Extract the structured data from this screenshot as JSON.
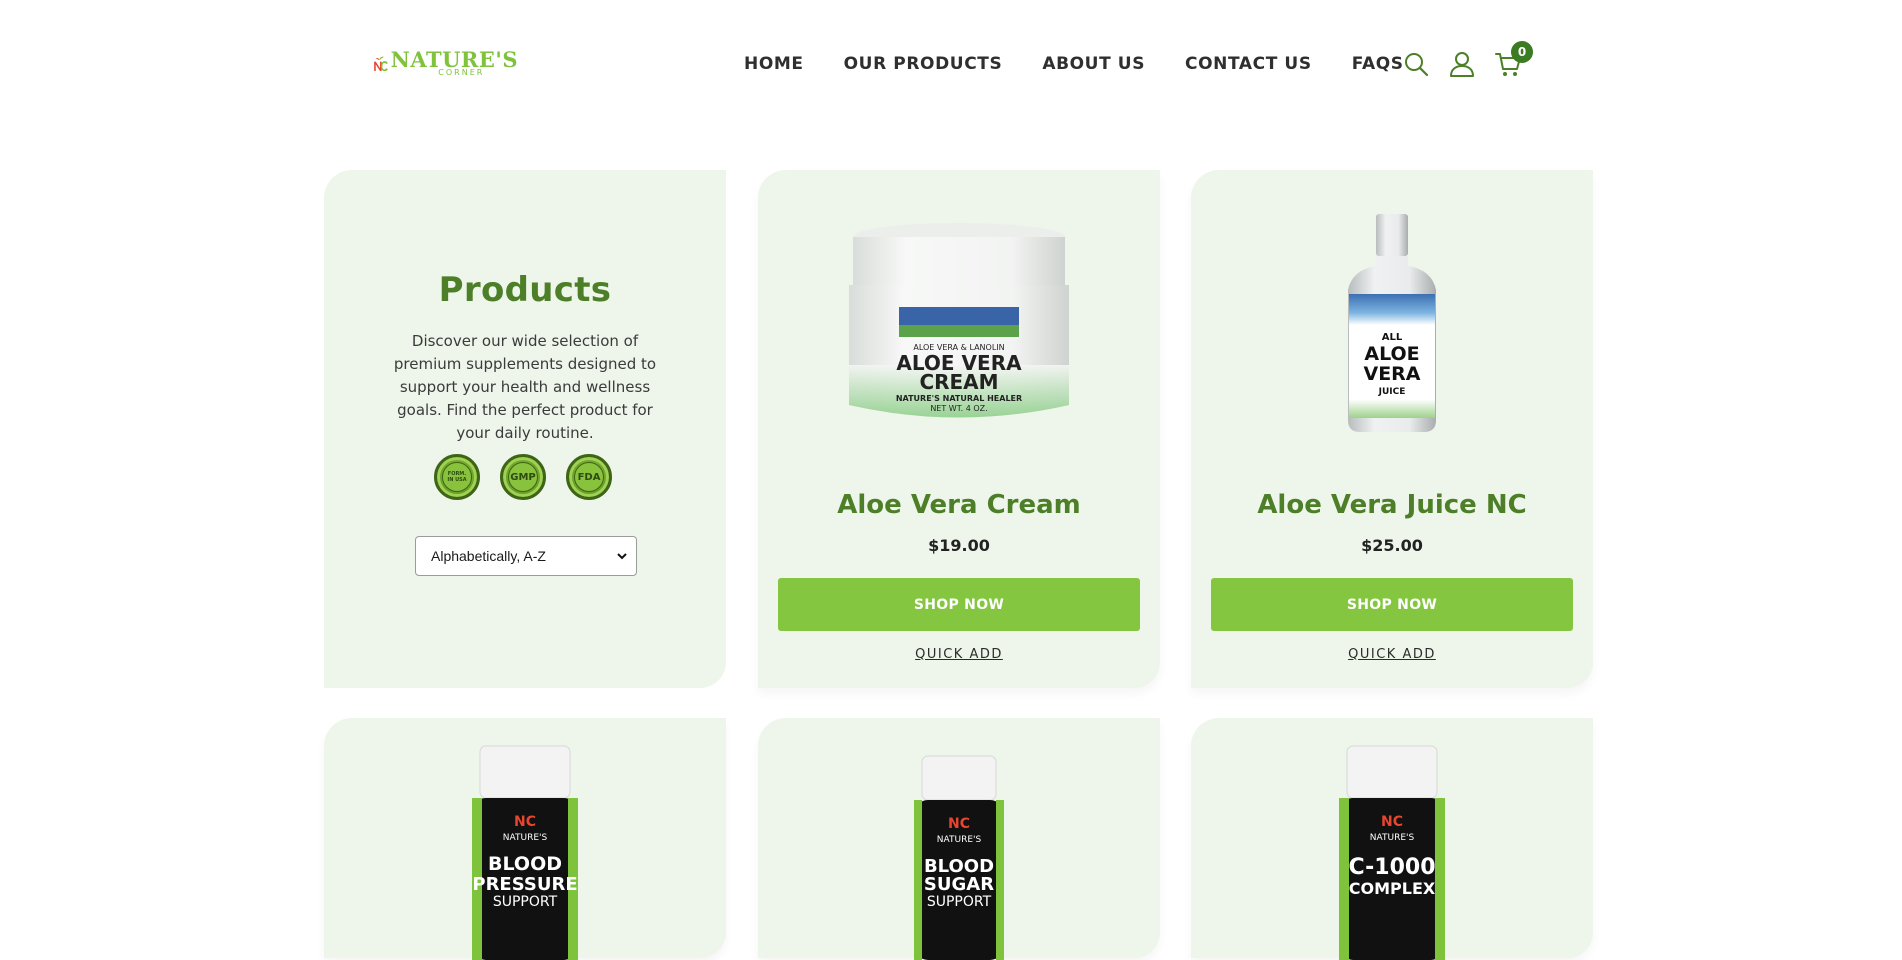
{
  "brand": {
    "logo_text": "NATURE'S",
    "logo_sub": "CORNER",
    "colors": {
      "primary_green": "#85c641",
      "dark_green": "#4c7f27",
      "card_bg": "#eef5ea",
      "logo_red": "#e8452e"
    }
  },
  "nav": {
    "items": [
      {
        "label": "HOME"
      },
      {
        "label": "OUR PRODUCTS"
      },
      {
        "label": "ABOUT US"
      },
      {
        "label": "CONTACT US"
      },
      {
        "label": "FAQS"
      }
    ]
  },
  "header_icons": {
    "search": "search-icon",
    "account": "user-icon",
    "cart": "cart-icon",
    "cart_count": "0"
  },
  "intro": {
    "title": "Products",
    "description": "Discover our wide selection of premium supplements designed to support your health and wellness goals. Find the perfect product for your daily routine.",
    "badges": [
      "FORMULATED IN USA",
      "GMP",
      "FDA"
    ],
    "sort": {
      "selected": "Alphabetically, A-Z"
    }
  },
  "products": [
    {
      "name": "Aloe Vera Cream",
      "price": "$19.00",
      "shop_label": "SHOP NOW",
      "quick_add_label": "QUICK ADD",
      "label_line1": "ALOE VERA & LANOLIN",
      "label_line2": "ALOE VERA",
      "label_line3": "CREAM",
      "label_line4": "NATURE'S NATURAL HEALER",
      "label_line5": "NET WT. 4 OZ."
    },
    {
      "name": "Aloe Vera Juice NC",
      "price": "$25.00",
      "shop_label": "SHOP NOW",
      "quick_add_label": "QUICK ADD",
      "label_line1": "ALL",
      "label_line2": "ALOE",
      "label_line3": "VERA",
      "label_line4": "JUICE"
    }
  ],
  "bottles": [
    {
      "brand": "NATURE'S",
      "line1": "BLOOD",
      "line2": "PRESSURE",
      "line3": "SUPPORT"
    },
    {
      "brand": "NATURE'S",
      "line1": "BLOOD",
      "line2": "SUGAR",
      "line3": "SUPPORT"
    },
    {
      "brand": "NATURE'S",
      "line1": "C-1000",
      "line2": "COMPLEX",
      "line3": ""
    }
  ]
}
